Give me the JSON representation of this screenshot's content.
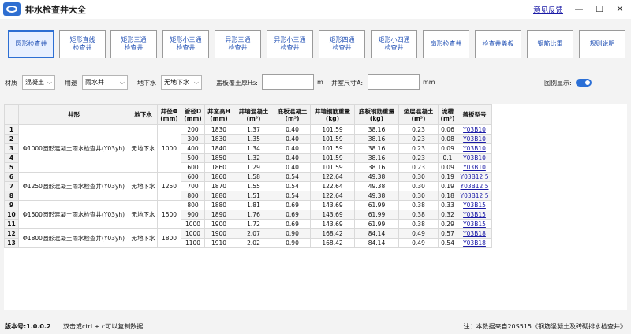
{
  "app": {
    "title": "排水检查井大全",
    "feedback": "意见反馈"
  },
  "window": {
    "minimize": "—",
    "maximize": "☐",
    "close": "✕"
  },
  "toolbar": {
    "buttons": [
      {
        "label": "圆形检查井"
      },
      {
        "label": "矩形直线\n检查井"
      },
      {
        "label": "矩形三通\n检查井"
      },
      {
        "label": "矩形小三通\n检查井"
      },
      {
        "label": "异形三通\n检查井"
      },
      {
        "label": "异形小三通\n检查井"
      },
      {
        "label": "矩形四通\n检查井"
      },
      {
        "label": "矩形小四通\n检查井"
      },
      {
        "label": "扇形检查井"
      },
      {
        "label": "检查井盖板"
      },
      {
        "label": "钢筋比重"
      },
      {
        "label": "规则说明"
      }
    ]
  },
  "filters": {
    "material_label": "材质",
    "material_value": "混凝土",
    "use_label": "用途",
    "use_value": "雨水井",
    "groundwater_label": "地下水",
    "groundwater_value": "无地下水",
    "cover_label": "盖板覆土厚Hs:",
    "cover_value": "",
    "cover_unit": "m",
    "size_label": "井室尺寸A:",
    "size_value": "",
    "size_unit": "mm",
    "legend_label": "图例显示:"
  },
  "table": {
    "headers": [
      "",
      "井形",
      "地下水",
      "井径Φ\n(mm)",
      "管径D\n(mm)",
      "井室高H\n(mm)",
      "井墙混凝土\n(m³)",
      "底板混凝土\n(m³)",
      "井墙钢筋重量\n(kg)",
      "底板钢筋重量\n(kg)",
      "垫层混凝土\n(m³)",
      "流槽\n(m³)",
      "盖板型号"
    ],
    "groups": [
      {
        "shape": "Φ1000圆形混凝土雨水检查井(Y03yh)",
        "water": "无地下水",
        "diam": "1000"
      },
      {
        "shape": "Φ1250圆形混凝土雨水检查井(Y03yh)",
        "water": "无地下水",
        "diam": "1250"
      },
      {
        "shape": "Φ1500圆形混凝土雨水检查井(Y03yh)",
        "water": "无地下水",
        "diam": "1500"
      },
      {
        "shape": "Φ1800圆形混凝土雨水检查井(Y03yh)",
        "water": "无地下水",
        "diam": "1800"
      }
    ],
    "rows": [
      {
        "n": "1",
        "d": "200",
        "h": "1830",
        "wc": "1.37",
        "bc": "0.40",
        "ws": "101.59",
        "bs": "38.16",
        "pc": "0.23",
        "fc": "0.06",
        "cover": "Y03B10"
      },
      {
        "n": "2",
        "d": "300",
        "h": "1830",
        "wc": "1.35",
        "bc": "0.40",
        "ws": "101.59",
        "bs": "38.16",
        "pc": "0.23",
        "fc": "0.08",
        "cover": "Y03B10"
      },
      {
        "n": "3",
        "d": "400",
        "h": "1840",
        "wc": "1.34",
        "bc": "0.40",
        "ws": "101.59",
        "bs": "38.16",
        "pc": "0.23",
        "fc": "0.09",
        "cover": "Y03B10"
      },
      {
        "n": "4",
        "d": "500",
        "h": "1850",
        "wc": "1.32",
        "bc": "0.40",
        "ws": "101.59",
        "bs": "38.16",
        "pc": "0.23",
        "fc": "0.1",
        "cover": "Y03B10"
      },
      {
        "n": "5",
        "d": "600",
        "h": "1860",
        "wc": "1.29",
        "bc": "0.40",
        "ws": "101.59",
        "bs": "38.16",
        "pc": "0.23",
        "fc": "0.09",
        "cover": "Y03B10"
      },
      {
        "n": "6",
        "d": "600",
        "h": "1860",
        "wc": "1.58",
        "bc": "0.54",
        "ws": "122.64",
        "bs": "49.38",
        "pc": "0.30",
        "fc": "0.19",
        "cover": "Y03B12.5"
      },
      {
        "n": "7",
        "d": "700",
        "h": "1870",
        "wc": "1.55",
        "bc": "0.54",
        "ws": "122.64",
        "bs": "49.38",
        "pc": "0.30",
        "fc": "0.19",
        "cover": "Y03B12.5"
      },
      {
        "n": "8",
        "d": "800",
        "h": "1880",
        "wc": "1.51",
        "bc": "0.54",
        "ws": "122.64",
        "bs": "49.38",
        "pc": "0.30",
        "fc": "0.18",
        "cover": "Y03B12.5"
      },
      {
        "n": "9",
        "d": "800",
        "h": "1880",
        "wc": "1.81",
        "bc": "0.69",
        "ws": "143.69",
        "bs": "61.99",
        "pc": "0.38",
        "fc": "0.33",
        "cover": "Y03B15"
      },
      {
        "n": "10",
        "d": "900",
        "h": "1890",
        "wc": "1.76",
        "bc": "0.69",
        "ws": "143.69",
        "bs": "61.99",
        "pc": "0.38",
        "fc": "0.32",
        "cover": "Y03B15"
      },
      {
        "n": "11",
        "d": "1000",
        "h": "1900",
        "wc": "1.72",
        "bc": "0.69",
        "ws": "143.69",
        "bs": "61.99",
        "pc": "0.38",
        "fc": "0.29",
        "cover": "Y03B15"
      },
      {
        "n": "12",
        "d": "1000",
        "h": "1900",
        "wc": "2.07",
        "bc": "0.90",
        "ws": "168.42",
        "bs": "84.14",
        "pc": "0.49",
        "fc": "0.57",
        "cover": "Y03B18"
      },
      {
        "n": "13",
        "d": "1100",
        "h": "1910",
        "wc": "2.02",
        "bc": "0.90",
        "ws": "168.42",
        "bs": "84.14",
        "pc": "0.49",
        "fc": "0.54",
        "cover": "Y03B18"
      }
    ]
  },
  "status": {
    "version": "版本号:1.0.0.2",
    "hint": "双击或ctrl + c可以复制数据",
    "note": "注：本数据来自20S515《钢筋混凝土及砖砌排水检查井》"
  }
}
